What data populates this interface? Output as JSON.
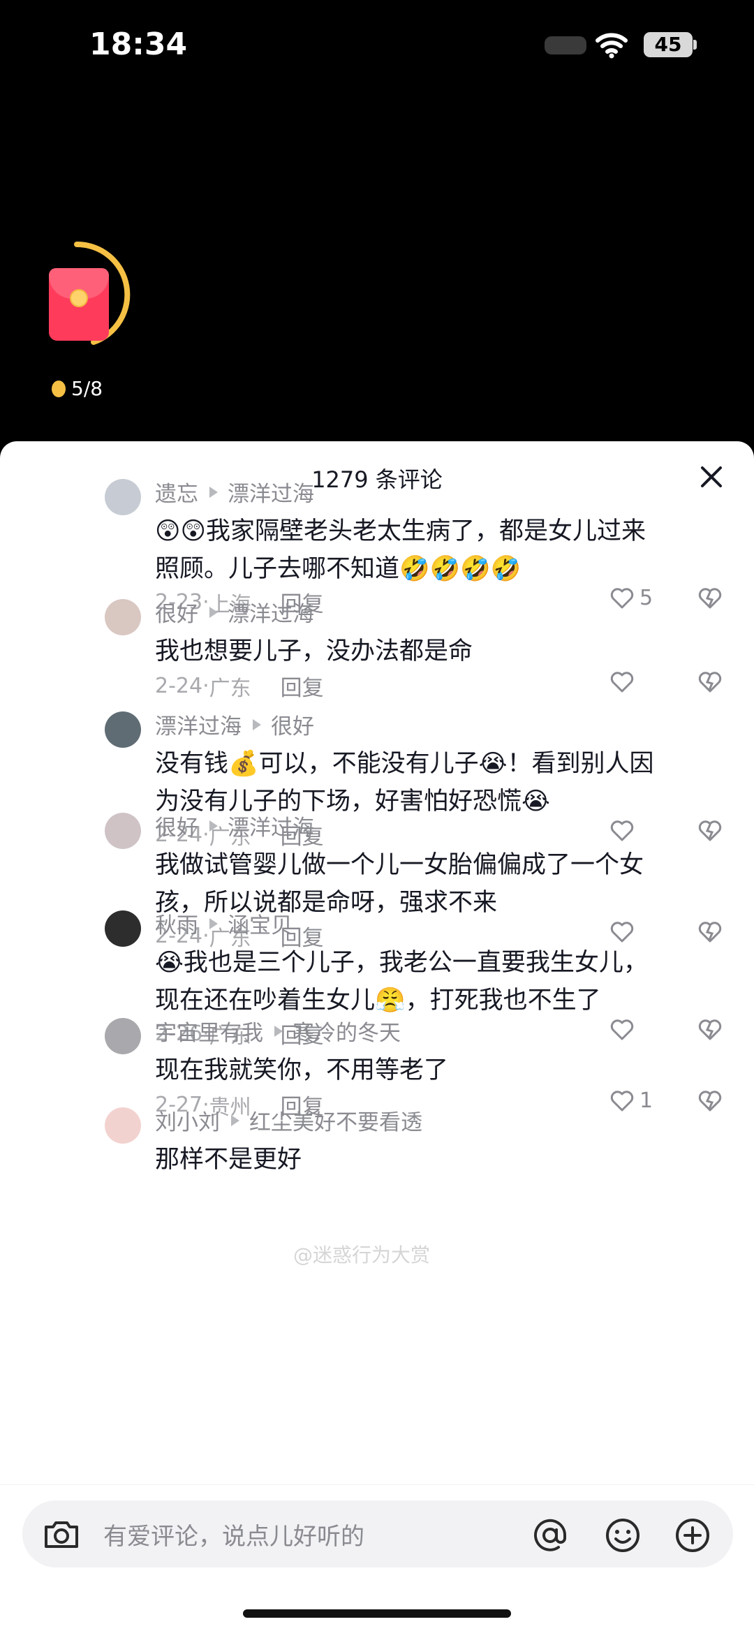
{
  "status_bar": {
    "time": "18:34",
    "battery": "45"
  },
  "red_packet": {
    "progress_text": "5/8",
    "progress_value": 0.625
  },
  "sheet": {
    "title": "1279 条评论"
  },
  "comments": [
    {
      "user": "遗忘",
      "reply_to": "漂洋过海",
      "text_lines": [
        "😲😲我家隔壁老头老太生病了，都是女儿过来",
        "照顾。儿子去哪不知道🤣🤣🤣🤣"
      ],
      "date": "2-23",
      "location": "上海",
      "likes": "5"
    },
    {
      "user": "很好",
      "reply_to": "漂洋过海",
      "text_lines": [
        "我也想要儿子，没办法都是命"
      ],
      "date": "2-24",
      "location": "广东",
      "likes": ""
    },
    {
      "user": "漂洋过海",
      "reply_to": "很好",
      "text_lines": [
        "没有钱💰可以，不能没有儿子😭！看到别人因",
        "为没有儿子的下场，好害怕好恐慌😭"
      ],
      "date": "2-24",
      "location": "广东",
      "likes": ""
    },
    {
      "user": "很好",
      "reply_to": "漂洋过海",
      "text_lines": [
        "我做试管婴儿做一个儿一女胎偏偏成了一个女",
        "孩，所以说都是命呀，强求不来"
      ],
      "date": "2-24",
      "location": "广东",
      "likes": ""
    },
    {
      "user": "秋雨",
      "reply_to": "涵宝贝",
      "text_lines": [
        "😭我也是三个儿子，我老公一直要我生女儿，",
        "现在还在吵着生女儿😤，打死我也不生了"
      ],
      "date": "2-26",
      "location": "广东",
      "likes": ""
    },
    {
      "user": "宇宙里有我",
      "reply_to": "寒冷的冬天",
      "text_lines": [
        "现在我就笑你，不用等老了"
      ],
      "date": "2-27",
      "location": "贵州",
      "likes": "1"
    },
    {
      "user": "刘小刘",
      "reply_to": "红尘美好不要看透",
      "text_lines": [
        "那样不是更好"
      ],
      "date": "",
      "location": "",
      "likes": ""
    }
  ],
  "labels": {
    "reply": "回复",
    "separator": "·"
  },
  "watermark": "@迷惑行为大赏",
  "input": {
    "placeholder": "有爱评论，说点儿好听的"
  },
  "icons": [
    "wifi-icon",
    "red-packet-icon",
    "coin-icon",
    "close-icon",
    "heart-icon",
    "dislike-heart-icon",
    "camera-icon",
    "at-icon",
    "emoji-icon",
    "plus-icon"
  ]
}
